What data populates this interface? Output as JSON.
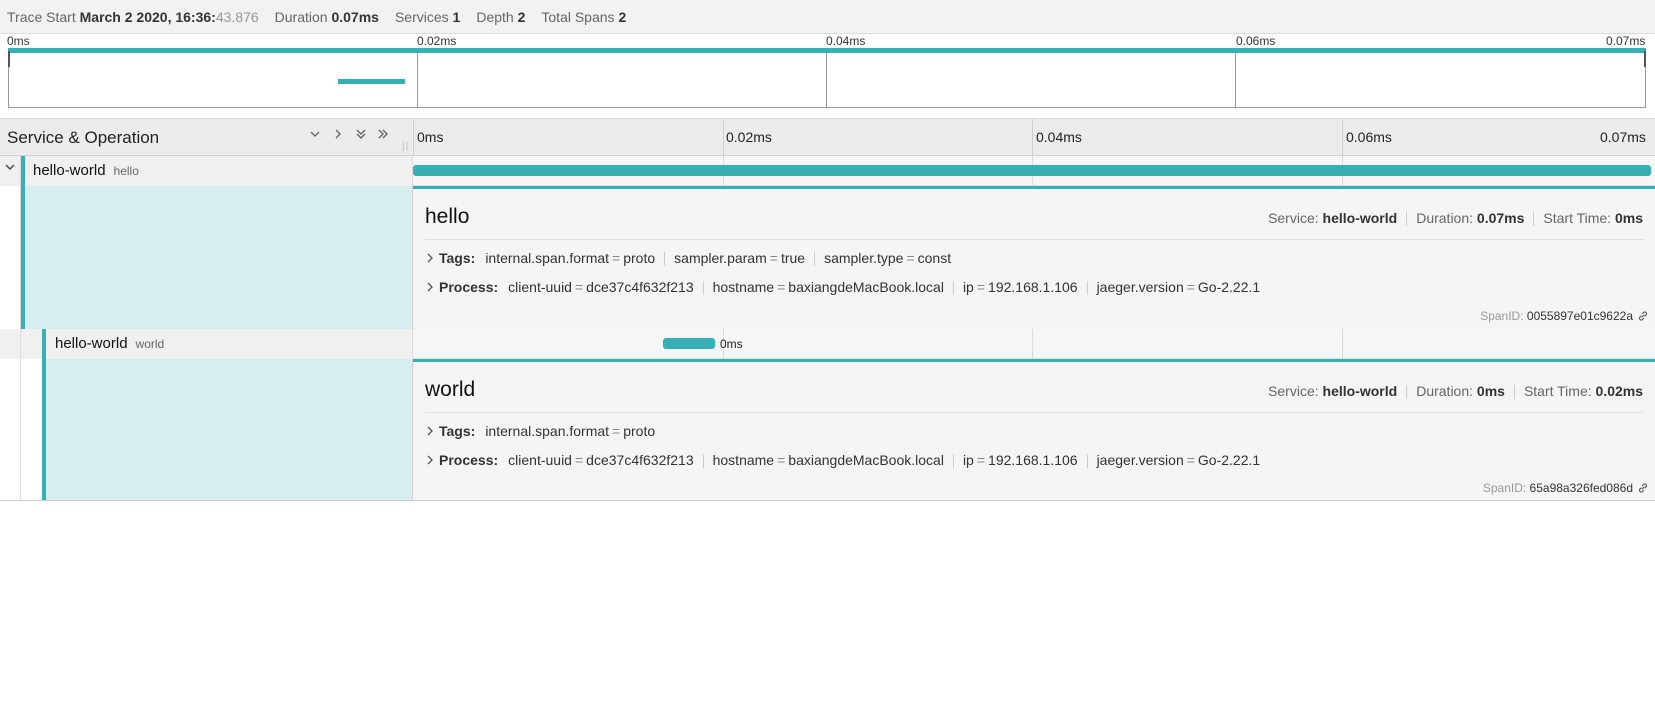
{
  "header": {
    "trace_start_label": "Trace Start",
    "trace_start_value": "March 2 2020, 16:36:",
    "trace_start_ms": "43.876",
    "duration_label": "Duration",
    "duration_value": "0.07ms",
    "services_label": "Services",
    "services_value": "1",
    "depth_label": "Depth",
    "depth_value": "2",
    "total_spans_label": "Total Spans",
    "total_spans_value": "2"
  },
  "minimap": {
    "ticks": [
      "0ms",
      "0.02ms",
      "0.04ms",
      "0.06ms",
      "0.07ms"
    ]
  },
  "timeline": {
    "title": "Service & Operation",
    "ticks": [
      "0ms",
      "0.02ms",
      "0.04ms",
      "0.06ms",
      "0.07ms"
    ]
  },
  "spans": [
    {
      "service": "hello-world",
      "operation": "hello",
      "detail": {
        "title": "hello",
        "service_label": "Service:",
        "service_value": "hello-world",
        "duration_label": "Duration:",
        "duration_value": "0.07ms",
        "start_label": "Start Time:",
        "start_value": "0ms",
        "tags_label": "Tags:",
        "tags": [
          {
            "key": "internal.span.format",
            "value": "proto"
          },
          {
            "key": "sampler.param",
            "value": "true"
          },
          {
            "key": "sampler.type",
            "value": "const"
          }
        ],
        "process_label": "Process:",
        "process": [
          {
            "key": "client-uuid",
            "value": "dce37c4f632f213"
          },
          {
            "key": "hostname",
            "value": "baxiangdeMacBook.local"
          },
          {
            "key": "ip",
            "value": "192.168.1.106"
          },
          {
            "key": "jaeger.version",
            "value": "Go-2.22.1"
          }
        ],
        "span_id_label": "SpanID:",
        "span_id": "0055897e01c9622a"
      }
    },
    {
      "service": "hello-world",
      "operation": "world",
      "bar_label": "0ms",
      "detail": {
        "title": "world",
        "service_label": "Service:",
        "service_value": "hello-world",
        "duration_label": "Duration:",
        "duration_value": "0ms",
        "start_label": "Start Time:",
        "start_value": "0.02ms",
        "tags_label": "Tags:",
        "tags": [
          {
            "key": "internal.span.format",
            "value": "proto"
          }
        ],
        "process_label": "Process:",
        "process": [
          {
            "key": "client-uuid",
            "value": "dce37c4f632f213"
          },
          {
            "key": "hostname",
            "value": "baxiangdeMacBook.local"
          },
          {
            "key": "ip",
            "value": "192.168.1.106"
          },
          {
            "key": "jaeger.version",
            "value": "Go-2.22.1"
          }
        ],
        "span_id_label": "SpanID:",
        "span_id": "65a98a326fed086d"
      }
    }
  ],
  "colors": {
    "accent": "#37b0b5",
    "detail_left_bg": "#d6eef0"
  },
  "icons": {
    "expander": "chevron-down-icon",
    "link": "link-icon",
    "collapse_one": "angle-down-icon",
    "expand_one": "angle-right-icon",
    "collapse_all": "double-angle-down-icon",
    "expand_all": "double-angle-right-icon"
  }
}
